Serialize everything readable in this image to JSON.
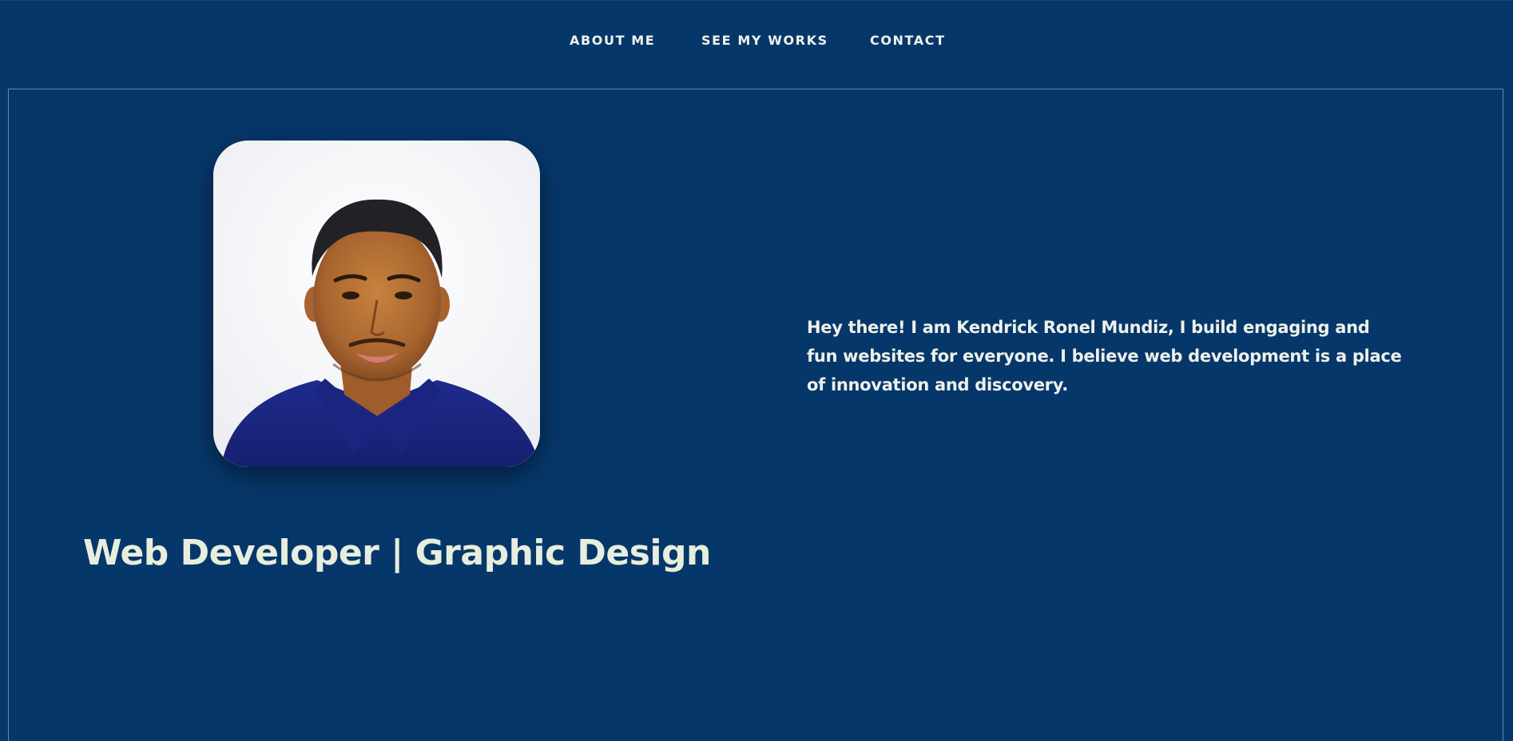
{
  "nav": {
    "items": [
      {
        "label": "ABOUT ME"
      },
      {
        "label": "SEE MY WORKS"
      },
      {
        "label": "CONTACT"
      }
    ]
  },
  "hero": {
    "photo_alt": "Portrait of Kendrick Ronel Mundiz",
    "role_title": "Web Developer | Graphic Design",
    "intro": "Hey there! I am Kendrick Ronel Mundiz, I build engaging and fun websites for everyone. I believe web development is a place of innovation and discovery."
  },
  "colors": {
    "background": "#06376a",
    "text": "#eef1ea",
    "frame_border": "#6f87a5"
  }
}
